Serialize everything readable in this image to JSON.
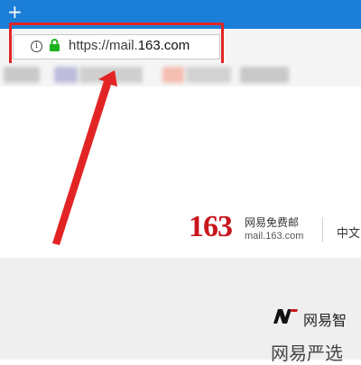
{
  "browser": {
    "new_tab_glyph": "+",
    "address": {
      "info_glyph": "i",
      "lock_color": "#1db31d",
      "url_prefix": "https://mail.",
      "url_host": "163.com"
    },
    "tabbar_color": "#1b7fd8"
  },
  "annotation": {
    "highlight_color": "#e32424"
  },
  "page": {
    "logo_number": "163",
    "logo_cn": "网易免费邮",
    "logo_domain": "mail.163.com",
    "language": "中文",
    "brand_text": "网易智",
    "promo_text": "网易严选",
    "brand_color": "#c8161d"
  }
}
